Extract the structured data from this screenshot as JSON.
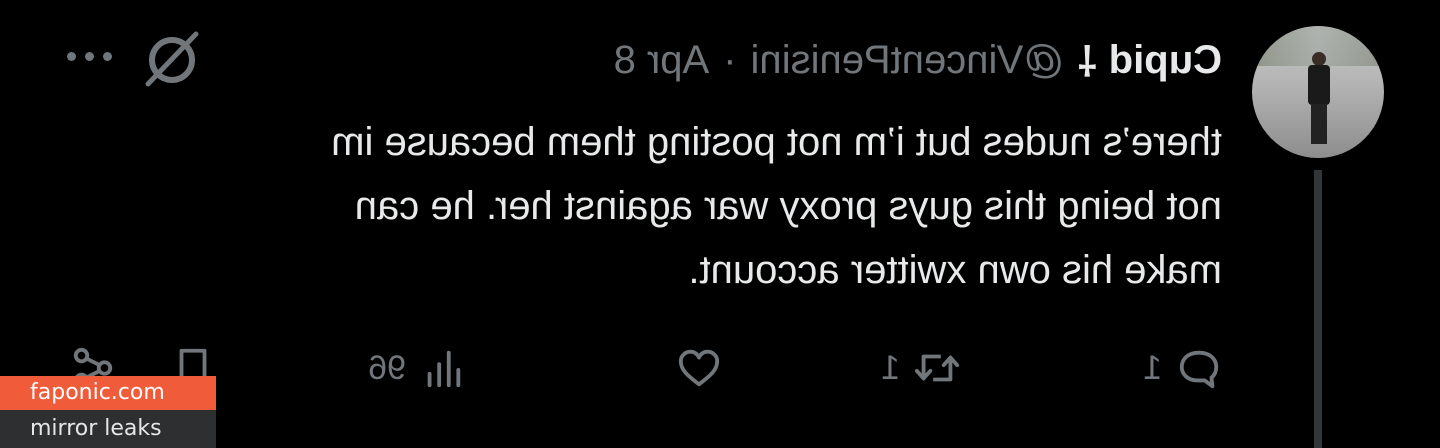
{
  "tweet": {
    "author": {
      "display_name": "Cupid",
      "badge_symbol": "⸸",
      "handle": "@VincentPenisini",
      "separator": "·",
      "date": "Apr 8"
    },
    "text_lines": [
      "there’s nudes but i’m not posting them because im",
      "not being this guys proxy war against her. he can",
      "make his own xwitter account."
    ],
    "actions": {
      "reply_count": "1",
      "retweet_count": "1",
      "like_count": "",
      "views_count": "96"
    },
    "icons": [
      "avatar",
      "grok-icon",
      "more-icon",
      "reply-icon",
      "retweet-icon",
      "like-icon",
      "views-icon",
      "bookmark-icon",
      "share-icon"
    ]
  },
  "watermark": {
    "site": "faponic.com",
    "tagline": "mirror leaks"
  },
  "colors": {
    "background": "#000000",
    "text": "#e7e9ea",
    "muted": "#71767b",
    "thread_line": "#333639",
    "watermark_accent": "#f05b3a"
  }
}
